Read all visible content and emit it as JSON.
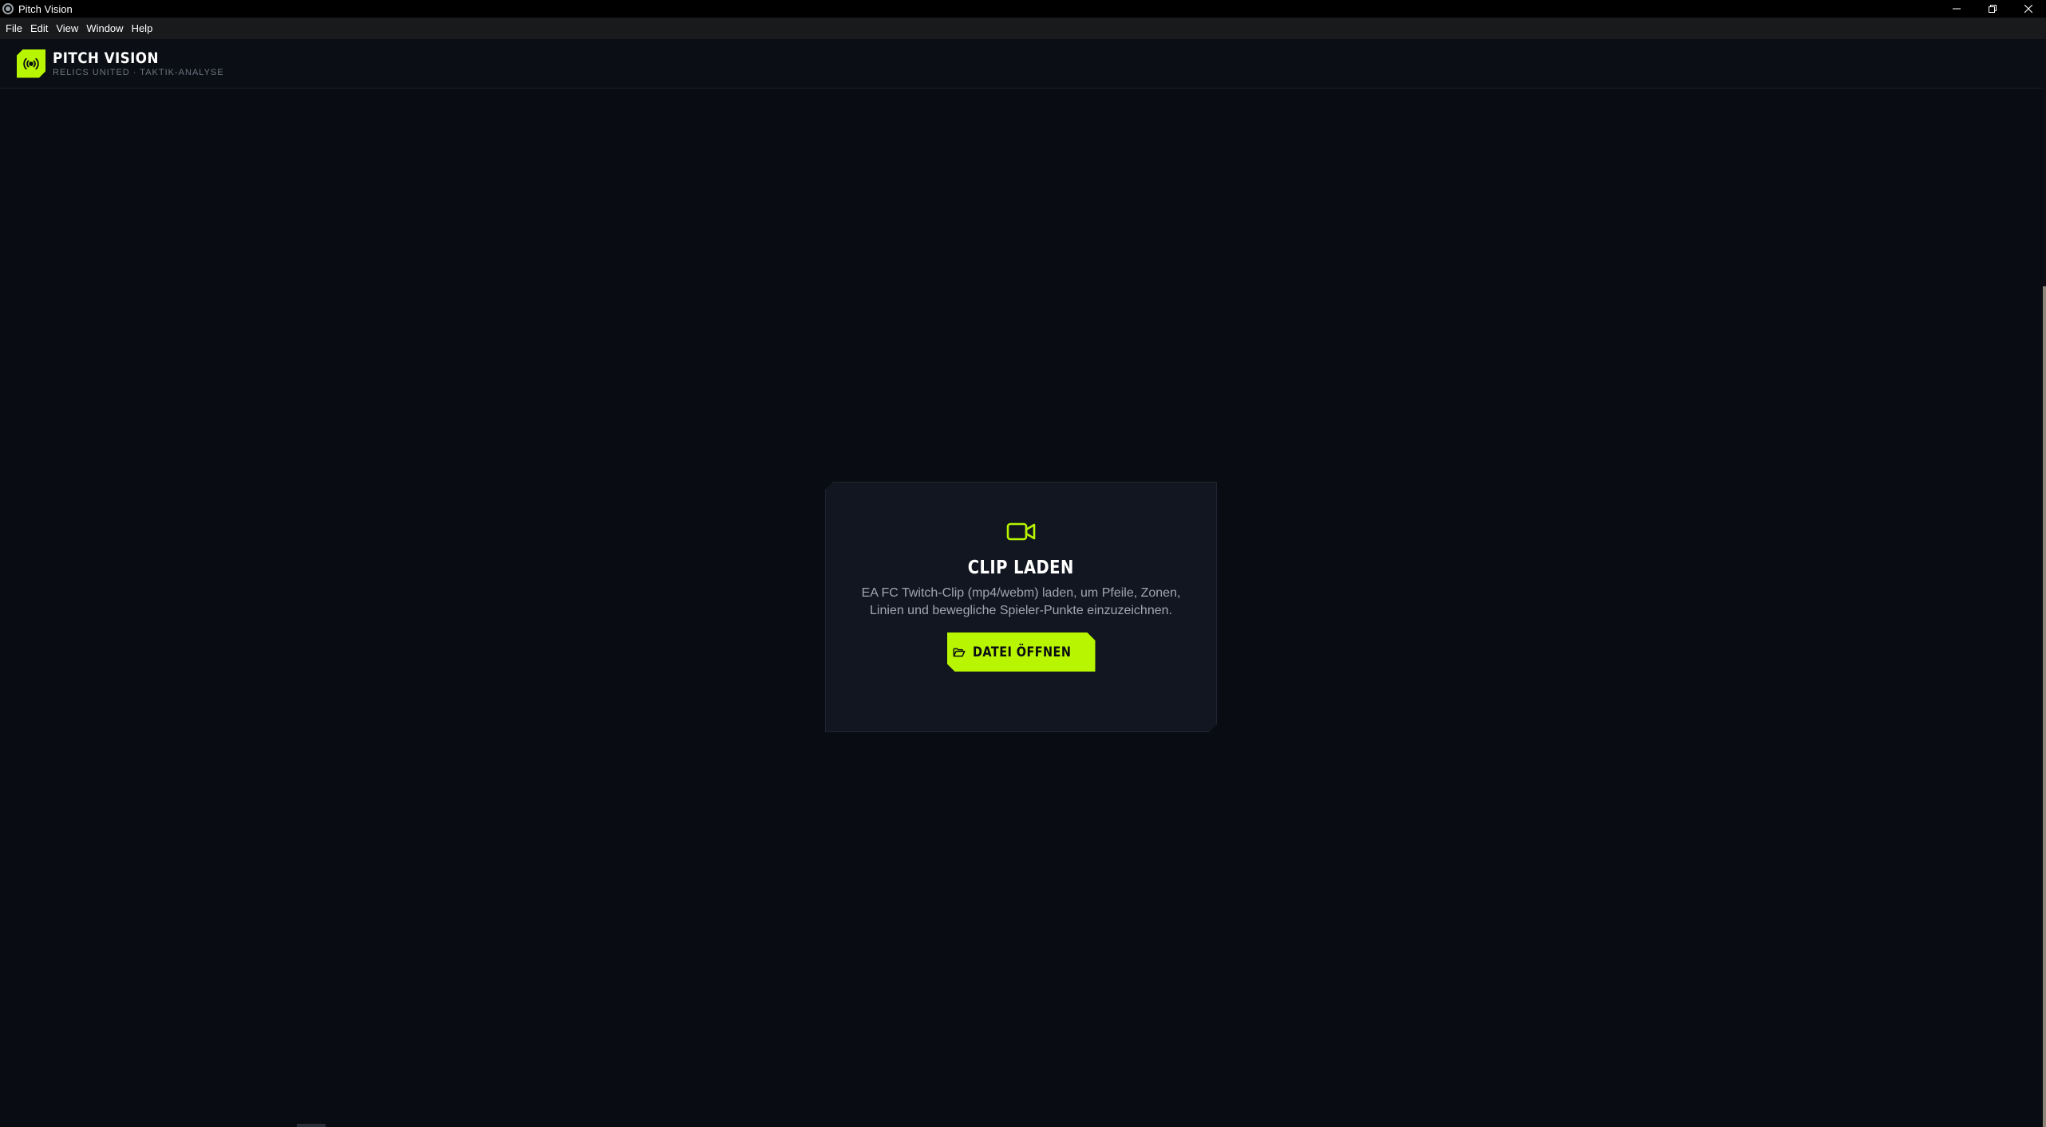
{
  "window": {
    "title": "Pitch Vision",
    "controls": {
      "minimize": "minimize-icon",
      "restore": "restore-icon",
      "close": "close-icon"
    }
  },
  "menu": [
    {
      "label": "File"
    },
    {
      "label": "Edit"
    },
    {
      "label": "View"
    },
    {
      "label": "Window"
    },
    {
      "label": "Help"
    }
  ],
  "header": {
    "logo_icon": "broadcast-icon",
    "title": "PITCH VISION",
    "subtitle": "RELICS UNITED · TAKTIK-ANALYSE"
  },
  "empty_state": {
    "icon": "video-camera-icon",
    "title": "CLIP LADEN",
    "description": "EA FC Twitch-Clip (mp4/webm) laden, um Pfeile, Zonen, Linien und bewegliche Spieler-Punkte einzuzeichnen.",
    "button_icon": "folder-open-icon",
    "button_label": "DATEI ÖFFNEN"
  },
  "colors": {
    "accent": "#b8f500",
    "background": "#090c13",
    "card": "#121620"
  }
}
